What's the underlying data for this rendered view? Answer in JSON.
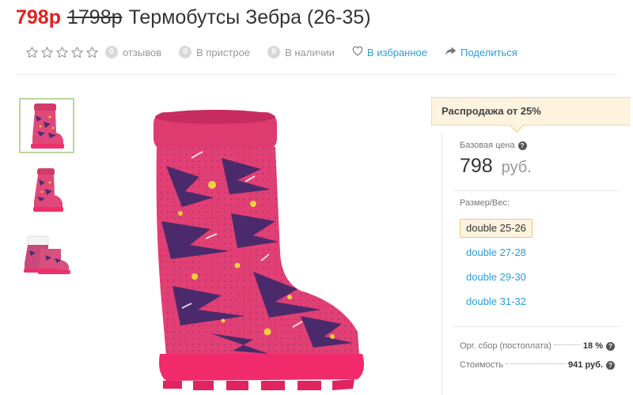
{
  "product": {
    "price_new": "798р",
    "price_old": "1798р",
    "title": "Термобутсы Зебра (26-35)"
  },
  "meta": {
    "rating_stars": 0,
    "reviews_count": "0",
    "reviews_label": "отзывов",
    "in_cart_count": "0",
    "in_cart_label": "В пристрое",
    "in_stock_count": "0",
    "in_stock_label": "В наличии",
    "favorites_label": "В избранное",
    "share_label": "Поделиться"
  },
  "gallery": {
    "thumbnails": [
      "boot-front-thumb",
      "boot-side-thumb",
      "boot-pair-thumb"
    ],
    "active_index": 0,
    "main_image": "pink-splatter-boot"
  },
  "sale": {
    "banner": "Распродажа от 25%"
  },
  "pricing": {
    "base_price_label": "Базовая цена",
    "base_price_value": "798",
    "base_price_currency": "руб.",
    "size_label": "Размер/Вес:",
    "sizes": [
      "double 25-26",
      "double 27-28",
      "double 29-30",
      "double 31-32"
    ],
    "selected_size_index": 0,
    "org_fee_label": "Орг. сбор (постоплата)",
    "org_fee_value": "18 %",
    "cost_label": "Стоимость",
    "cost_value": "941 руб."
  },
  "colors": {
    "accent": "#2a9fd6",
    "price_red": "#e02020",
    "boot_pink": "#e8346a",
    "sale_bg": "#fdf3df"
  }
}
